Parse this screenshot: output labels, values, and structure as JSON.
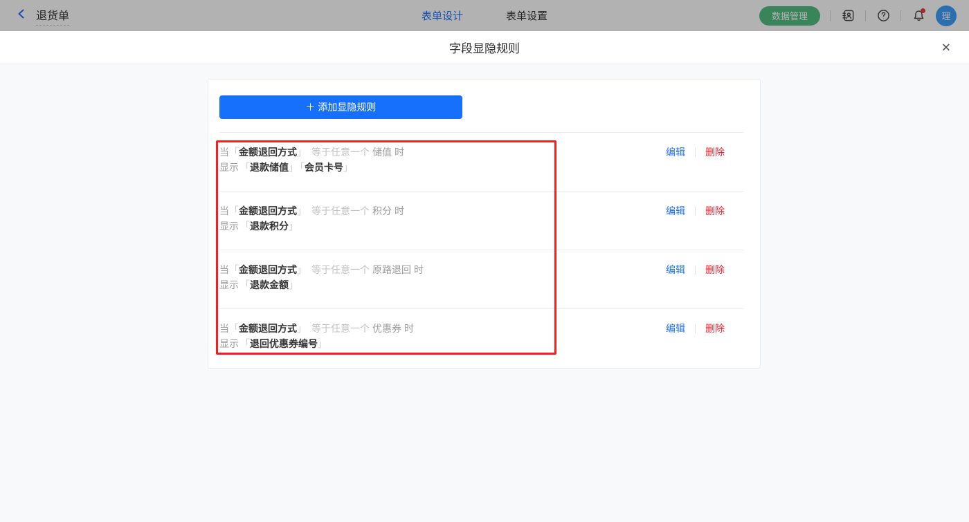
{
  "topbar": {
    "app_title": "退货单",
    "tabs": [
      {
        "label": "表单设计",
        "active": true
      },
      {
        "label": "表单设置",
        "active": false
      }
    ],
    "data_manage_label": "数据管理",
    "icons": [
      "contacts-icon",
      "help-icon",
      "bell-icon"
    ],
    "notification_badge": true,
    "avatar_text": "理"
  },
  "modal": {
    "title": "字段显隐规则",
    "close_glyph": "✕",
    "add_button_label": "＋ 添加显隐规则",
    "labels": {
      "when": "当",
      "suffix": "时",
      "show": "显示",
      "bracket_open": "「",
      "bracket_close": "」"
    },
    "edit_label": "编辑",
    "delete_label": "删除",
    "rules": [
      {
        "field": "金额退回方式",
        "operator": "等于任意一个",
        "value": "储值",
        "show_fields": [
          "退款储值",
          "会员卡号"
        ]
      },
      {
        "field": "金额退回方式",
        "operator": "等于任意一个",
        "value": "积分",
        "show_fields": [
          "退款积分"
        ]
      },
      {
        "field": "金额退回方式",
        "operator": "等于任意一个",
        "value": "原路退回",
        "show_fields": [
          "退款金额"
        ]
      },
      {
        "field": "金额退回方式",
        "operator": "等于任意一个",
        "value": "优惠券",
        "show_fields": [
          "退回优惠券编号"
        ]
      }
    ]
  },
  "colors": {
    "accent_blue": "#1670fb",
    "link_blue": "#1f6fff",
    "tab_active_blue": "#1c6fff",
    "danger_red": "#f5222d",
    "annotation_red": "#f91e1e",
    "green_button": "#53bd81",
    "avatar_blue": "#3d9efc"
  }
}
